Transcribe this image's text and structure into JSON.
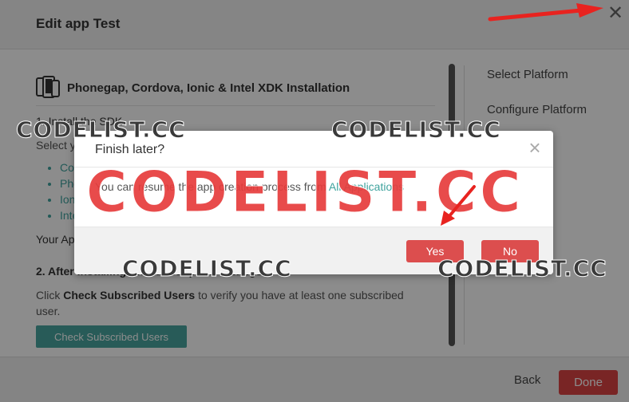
{
  "editor": {
    "title": "Edit app Test",
    "close_glyph": "✕",
    "platform_title": "Phonegap, Cordova, Ionic & Intel XDK Installation",
    "step1": "1. Install the SDK",
    "select_text": "Select y",
    "bullets": [
      "Co",
      "Pho",
      "Ion",
      "Inte"
    ],
    "your_app": "Your Ap",
    "step2": "2. After installing the subscription settings",
    "click_prefix": "Click ",
    "click_bold": "Check Subscribed Users",
    "click_suffix": " to verify you have at least one subscribed user.",
    "check_button": "Check Subscribed Users",
    "side_steps": [
      "Select Platform",
      "Configure Platform"
    ],
    "back_label": "Back",
    "done_label": "Done"
  },
  "dialog": {
    "title": "Finish later?",
    "close_glyph": "×",
    "body_text": "You can resume the app creation process from ",
    "body_link": "All Applications",
    "yes_label": "Yes",
    "no_label": "No"
  },
  "watermarks": {
    "small": "CODELIST.CC",
    "big": "CODELIST.CC"
  },
  "colors": {
    "accent_teal": "#49a7a0",
    "button_red": "#dc4e4e",
    "arrow_red": "#e8231f"
  },
  "icons": {
    "device": "mobile-devices-icon",
    "close": "close-icon"
  }
}
